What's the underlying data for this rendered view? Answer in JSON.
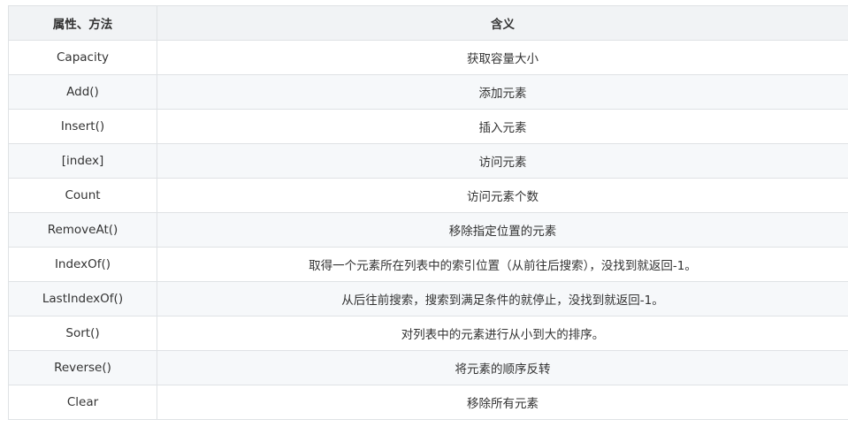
{
  "table": {
    "headers": [
      "属性、方法",
      "含义"
    ],
    "rows": [
      {
        "name": "Capacity",
        "meaning": "获取容量大小"
      },
      {
        "name": "Add()",
        "meaning": "添加元素"
      },
      {
        "name": "Insert()",
        "meaning": "插入元素"
      },
      {
        "name": "[index]",
        "meaning": "访问元素"
      },
      {
        "name": "Count",
        "meaning": "访问元素个数"
      },
      {
        "name": "RemoveAt()",
        "meaning": "移除指定位置的元素"
      },
      {
        "name": "IndexOf()",
        "meaning": "取得一个元素所在列表中的索引位置（从前往后搜索），没找到就返回-1。"
      },
      {
        "name": "LastIndexOf()",
        "meaning": "从后往前搜索，搜索到满足条件的就停止，没找到就返回-1。"
      },
      {
        "name": "Sort()",
        "meaning": "对列表中的元素进行从小到大的排序。"
      },
      {
        "name": "Reverse()",
        "meaning": "将元素的顺序反转"
      },
      {
        "name": "Clear",
        "meaning": "移除所有元素"
      }
    ]
  },
  "colors": {
    "header_bg": "#f1f3f5",
    "stripe_bg": "#f6f8fa",
    "border": "#dfe2e5",
    "text": "#333333"
  }
}
